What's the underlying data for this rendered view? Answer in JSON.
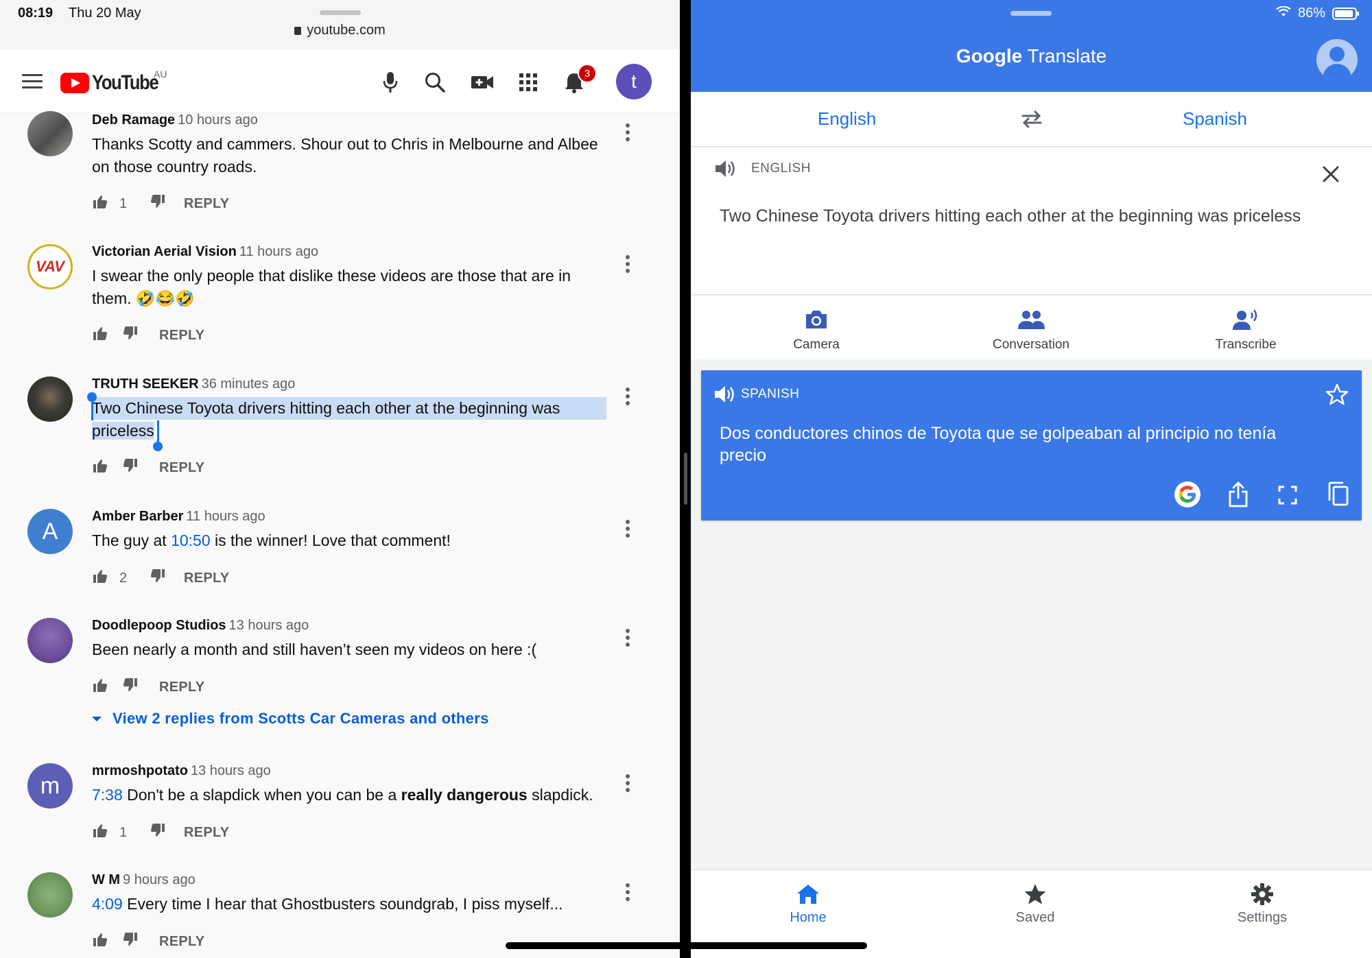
{
  "youtube": {
    "status": {
      "time": "08:19",
      "date": "Thu 20 May"
    },
    "url": "youtube.com",
    "header": {
      "logo_text": "YouTube",
      "region": "AU",
      "notification_count": "3",
      "avatar_letter": "t"
    },
    "comments": [
      {
        "author": "Deb Ramage",
        "time": "10 hours ago",
        "text": "Thanks Scotty and cammers.  Shour out to Chris in Melbourne and Albee on those country roads.",
        "likes": "1",
        "reply": "REPLY"
      },
      {
        "author": "Victorian Aerial Vision",
        "time": "11 hours ago",
        "text": "I swear the only people that dislike these videos are those that are in them. 🤣😂🤣",
        "likes": "",
        "reply": "REPLY",
        "avatar_text": "VAV"
      },
      {
        "author": "TRUTH SEEKER",
        "time": "36 minutes ago",
        "text_line1": "Two Chinese Toyota drivers hitting each other at the beginning was",
        "text_line2": "priceless",
        "likes": "",
        "reply": "REPLY"
      },
      {
        "author": "Amber Barber",
        "time": "11 hours ago",
        "text_before": "The guy at ",
        "timestamp_link": "10:50",
        "text_after": " is the winner! Love that comment!",
        "likes": "2",
        "reply": "REPLY",
        "avatar_letter": "A",
        "avatar_color": "#3f7fd0"
      },
      {
        "author": "Doodlepoop Studios",
        "time": "13 hours ago",
        "text": "Been nearly a month and still haven’t seen my videos on here :(",
        "likes": "",
        "reply": "REPLY",
        "view_replies": "View 2 replies from Scotts Car Cameras and others"
      },
      {
        "author": "mrmoshpotato",
        "time": "13 hours ago",
        "timestamp_link": "7:38",
        "text_before": " Don't be a slapdick when you can be a ",
        "text_bold": "really dangerous",
        "text_after": " slapdick.",
        "likes": "1",
        "reply": "REPLY",
        "avatar_letter": "m",
        "avatar_color": "#5c5fb6"
      },
      {
        "author": "W M",
        "time": "9 hours ago",
        "timestamp_link": "4:09",
        "text_after": " Every time I hear that Ghostbusters soundgrab, I piss myself...",
        "likes": "",
        "reply": "REPLY"
      }
    ]
  },
  "translate": {
    "status": {
      "battery": "86%"
    },
    "title_bold": "Google",
    "title_rest": " Translate",
    "source_lang": "English",
    "target_lang": "Spanish",
    "source_label": "ENGLISH",
    "source_text": "Two Chinese Toyota drivers hitting each other at the beginning was priceless",
    "tools": [
      "Camera",
      "Conversation",
      "Transcribe"
    ],
    "target_label": "SPANISH",
    "target_text": "Dos conductores chinos de Toyota que se golpeaban al principio no tenía precio",
    "nav": [
      "Home",
      "Saved",
      "Settings"
    ],
    "colors": {
      "brand_blue": "#3b78e7",
      "link_blue": "#1a73e8",
      "yt_red": "#ff0000"
    }
  }
}
